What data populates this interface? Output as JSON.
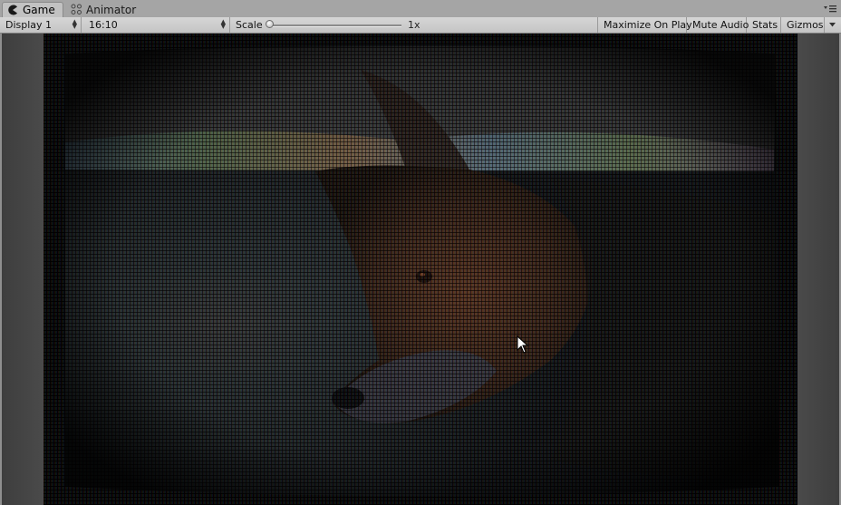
{
  "tabs": [
    {
      "label": "Game",
      "icon": "pacman-game-icon",
      "active": true
    },
    {
      "label": "Animator",
      "icon": "animator-icon",
      "active": false
    }
  ],
  "tab_menu_icon": "window-menu-icon",
  "toolbar": {
    "display": "Display 1",
    "aspect": "16:10",
    "scale_label": "Scale",
    "scale_value": "1x",
    "scale_fraction": 0.0,
    "maximize_on_play": "Maximize On Play",
    "mute_audio": "Mute Audio",
    "stats": "Stats",
    "gizmos": "Gizmos"
  },
  "game_view": {
    "content": "CRT-filtered render of a fox face",
    "cursor_icon": "mouse-pointer-icon"
  },
  "colors": {
    "window_bg": "#c2c2c2",
    "tabstrip_bg": "#a5a5a5",
    "viewport_side": "#464646",
    "render_bg": "#050505"
  }
}
